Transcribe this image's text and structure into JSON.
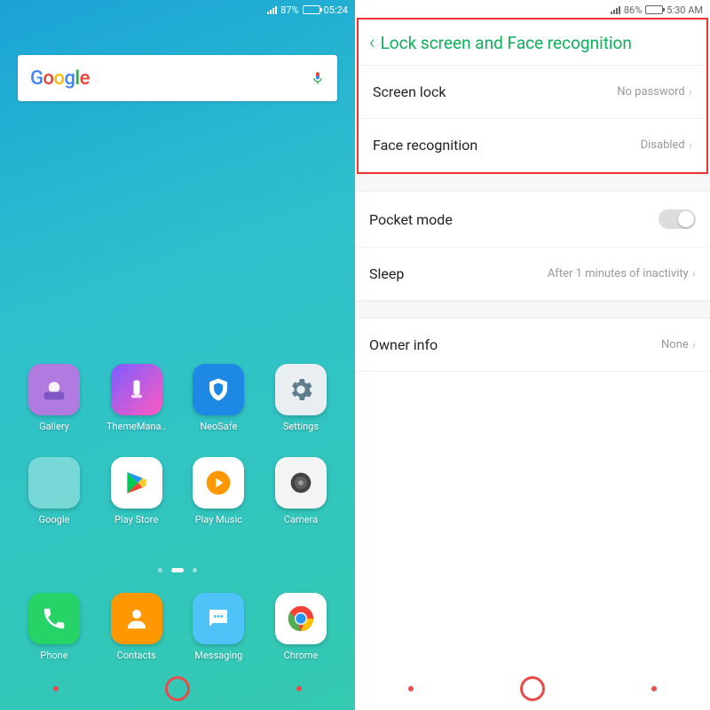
{
  "left": {
    "status": {
      "battery_pct": "87%",
      "time": "05:24"
    },
    "search": {
      "logo_name": "google-logo",
      "mic_name": "mic-icon"
    },
    "apps_row1": [
      {
        "label": "Gallery",
        "bg": "#b17ae0"
      },
      {
        "label": "ThemeMana..",
        "bg": "linear-gradient(135deg,#7b5cff,#ff5bc0)"
      },
      {
        "label": "NeoSafe",
        "bg": "#1e88e5"
      },
      {
        "label": "Settings",
        "bg": "#e9eef3"
      }
    ],
    "apps_row2": [
      {
        "label": "Google",
        "bg": "folder"
      },
      {
        "label": "Play Store",
        "bg": "#fff"
      },
      {
        "label": "Play Music",
        "bg": "#fff"
      },
      {
        "label": "Camera",
        "bg": "#f4f4f4"
      }
    ],
    "dock": [
      {
        "label": "Phone",
        "bg": "#25d366"
      },
      {
        "label": "Contacts",
        "bg": "#ff9800"
      },
      {
        "label": "Messaging",
        "bg": "#4fc3f7"
      },
      {
        "label": "Chrome",
        "bg": "#fff"
      }
    ]
  },
  "right": {
    "status": {
      "battery_pct": "86%",
      "time": "5:30 AM"
    },
    "title": "Lock screen and Face recognition",
    "items": [
      {
        "label": "Screen lock",
        "value": "No password"
      },
      {
        "label": "Face recognition",
        "value": "Disabled"
      }
    ],
    "extra": [
      {
        "label": "Pocket mode",
        "type": "toggle",
        "value": "off"
      },
      {
        "label": "Sleep",
        "value": "After 1 minutes of inactivity"
      },
      {
        "label": "Owner info",
        "value": "None"
      }
    ]
  }
}
